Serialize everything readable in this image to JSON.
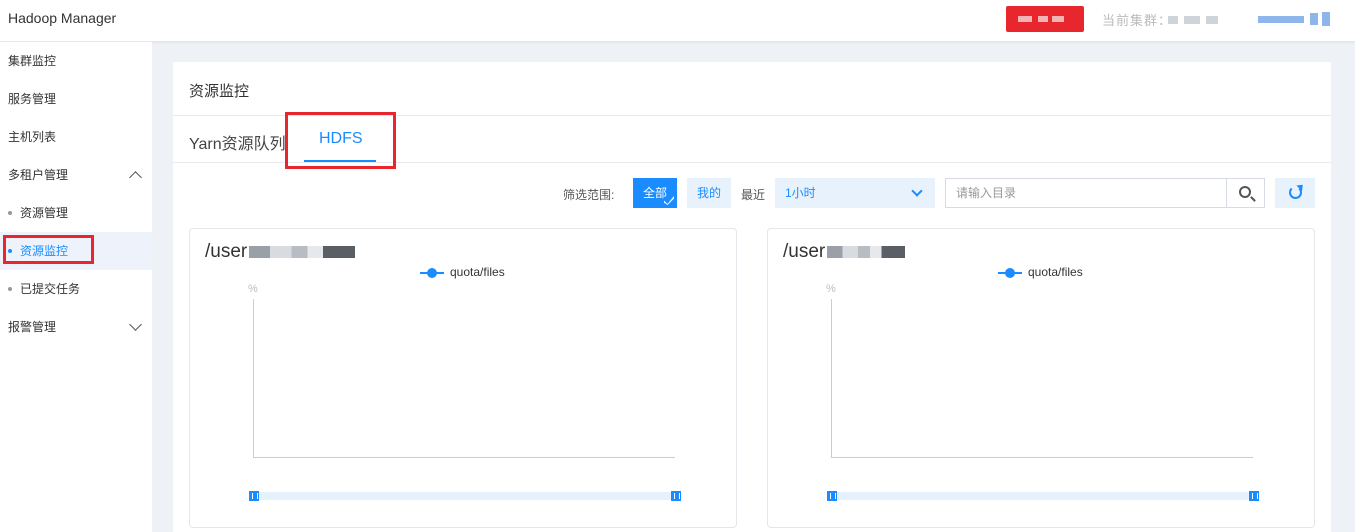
{
  "header": {
    "app_title": "Hadoop Manager",
    "cluster_label": "当前集群："
  },
  "sidebar": {
    "items": [
      {
        "label": "集群监控"
      },
      {
        "label": "服务管理"
      },
      {
        "label": "主机列表"
      },
      {
        "label": "多租户管理",
        "expanded": true
      },
      {
        "label": "资源管理"
      },
      {
        "label": "资源监控",
        "active": true
      },
      {
        "label": "已提交任务"
      },
      {
        "label": "报警管理",
        "expanded": false
      }
    ]
  },
  "panel": {
    "title": "资源监控",
    "tabs": [
      {
        "label": "Yarn资源队列"
      },
      {
        "label": "HDFS",
        "active": true
      }
    ]
  },
  "filters": {
    "scope_label": "筛选范围:",
    "scope_all": "全部",
    "scope_mine": "我的",
    "recent_label": "最近",
    "recent_value": "1小时",
    "search_placeholder": "请输入目录"
  },
  "charts": [
    {
      "title": "/user",
      "legend": "quota/files",
      "unit": "%"
    },
    {
      "title": "/user",
      "legend": "quota/files",
      "unit": "%"
    }
  ],
  "colors": {
    "accent": "#1a8cff",
    "highlight": "#e8262d"
  }
}
